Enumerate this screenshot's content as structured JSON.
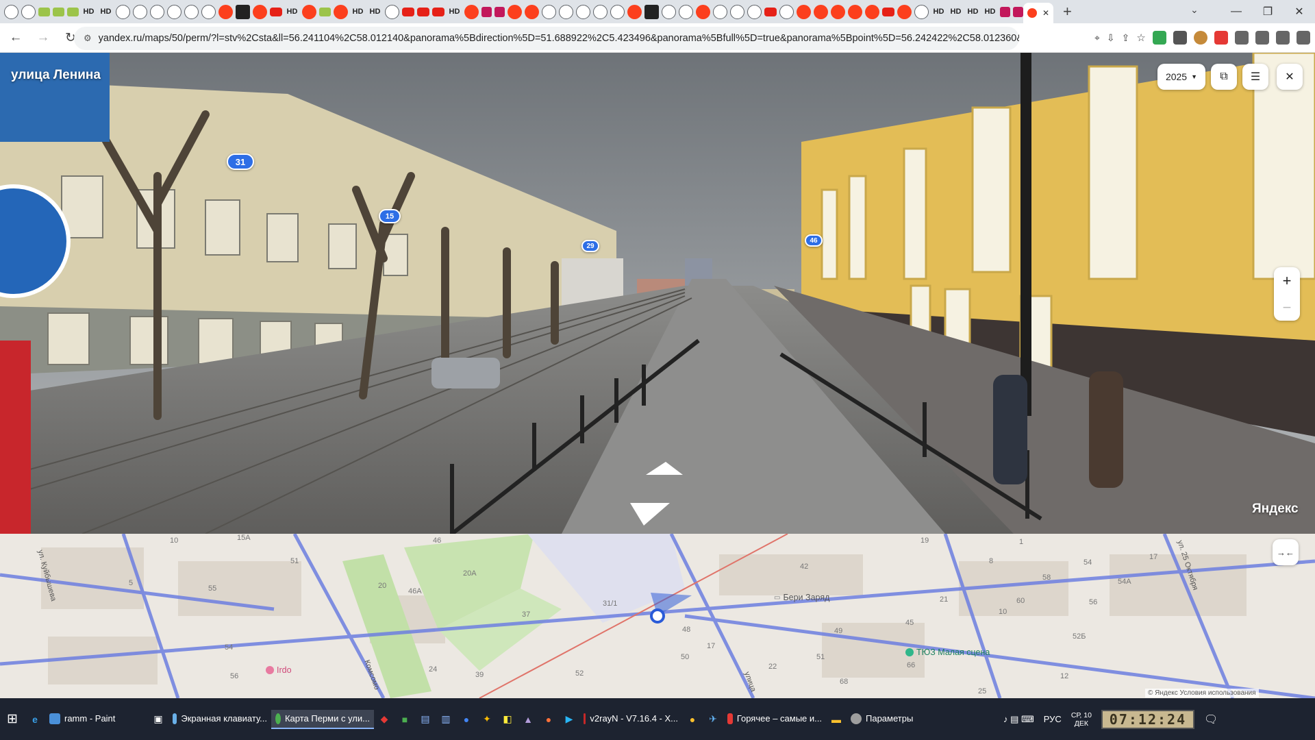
{
  "browser": {
    "active_tab_close": "✕",
    "new_tab": "+",
    "tab_search": "⌄",
    "window": {
      "minimize": "—",
      "maximize": "❐",
      "close": "✕"
    },
    "nav": {
      "back": "←",
      "forward": "→",
      "reload": "↻"
    },
    "url": "yandex.ru/maps/50/perm/?l=stv%2Csta&ll=56.241104%2C58.012140&panorama%5Bdirection%5D=51.688922%2C5.423496&panorama%5Bfull%5D=true&panorama%5Bpoint%5D=56.242422%2C58.012360&pano...",
    "tab_favicons": [
      "globe",
      "globe",
      "ok",
      "ok",
      "ok",
      "HD",
      "HD",
      "globe",
      "globe",
      "globe",
      "globe",
      "globe",
      "globe",
      "ya",
      "dk",
      "ya",
      "yt",
      "HD",
      "ya",
      "ok",
      "ya",
      "HD",
      "HD",
      "globe",
      "yt",
      "yt",
      "yt",
      "HD",
      "ya",
      "pk",
      "pk",
      "ya",
      "ya",
      "globe",
      "globe",
      "globe",
      "globe",
      "globe",
      "ya",
      "dk",
      "globe",
      "globe",
      "ya",
      "globe",
      "globe",
      "globe",
      "yt",
      "globe",
      "ya",
      "ya",
      "ya",
      "ya",
      "ya",
      "yt",
      "ya",
      "globe",
      "HD",
      "HD",
      "HD",
      "HD",
      "pk",
      "pk"
    ]
  },
  "panorama": {
    "street_name": "улица Ленина",
    "year": "2025",
    "year_arrow": "▼",
    "open_icon": "⧉",
    "menu_icon": "☰",
    "close_icon": "✕",
    "zoom_in": "+",
    "zoom_out": "−",
    "brand": "Яндекс",
    "house_badges": [
      "31",
      "15",
      "29",
      "46"
    ]
  },
  "map": {
    "labels": [
      "10",
      "15А",
      "46",
      "51",
      "55",
      "5",
      "20",
      "46А",
      "20А",
      "31/1",
      "37",
      "42",
      "48",
      "17",
      "50",
      "52",
      "39",
      "24",
      "54",
      "56",
      "49",
      "45",
      "51",
      "21",
      "10",
      "60",
      "58",
      "54",
      "54А",
      "56",
      "52Б",
      "12",
      "22",
      "66",
      "68",
      "25",
      "19",
      "8",
      "1",
      "17"
    ],
    "streets": [
      "ул. Куйбышева",
      "Комсомо",
      "ул. 25 Октября",
      "улица"
    ],
    "pois": {
      "beri_zaryad": "Бери Заряд",
      "tyuz": "ТЮЗ Малая сцена",
      "irdo": "Irdo"
    },
    "collapse_icon": "→←",
    "copyright": "© Яндекс  Условия использования"
  },
  "taskbar": {
    "start_icon": "⊞",
    "apps": [
      {
        "label": "ramm - Paint",
        "color": "#4a90d9"
      },
      {
        "label": "Экранная клавиату...",
        "color": "#6ab0e8"
      },
      {
        "label": "Карта Перми с ули...",
        "color": "#4caf50",
        "active": true
      },
      {
        "label": "v2rayN - V7.16.4 - X...",
        "color": "#c62828"
      },
      {
        "label": "Горячее – самые и...",
        "color": "#e53935"
      },
      {
        "label": "Параметры",
        "color": "#9e9e9e"
      }
    ],
    "lang": "РУС",
    "date_line1": "СР, 10",
    "date_line2": "ДЕК",
    "clock": "07:12:24",
    "notify_icon": "🗨"
  }
}
